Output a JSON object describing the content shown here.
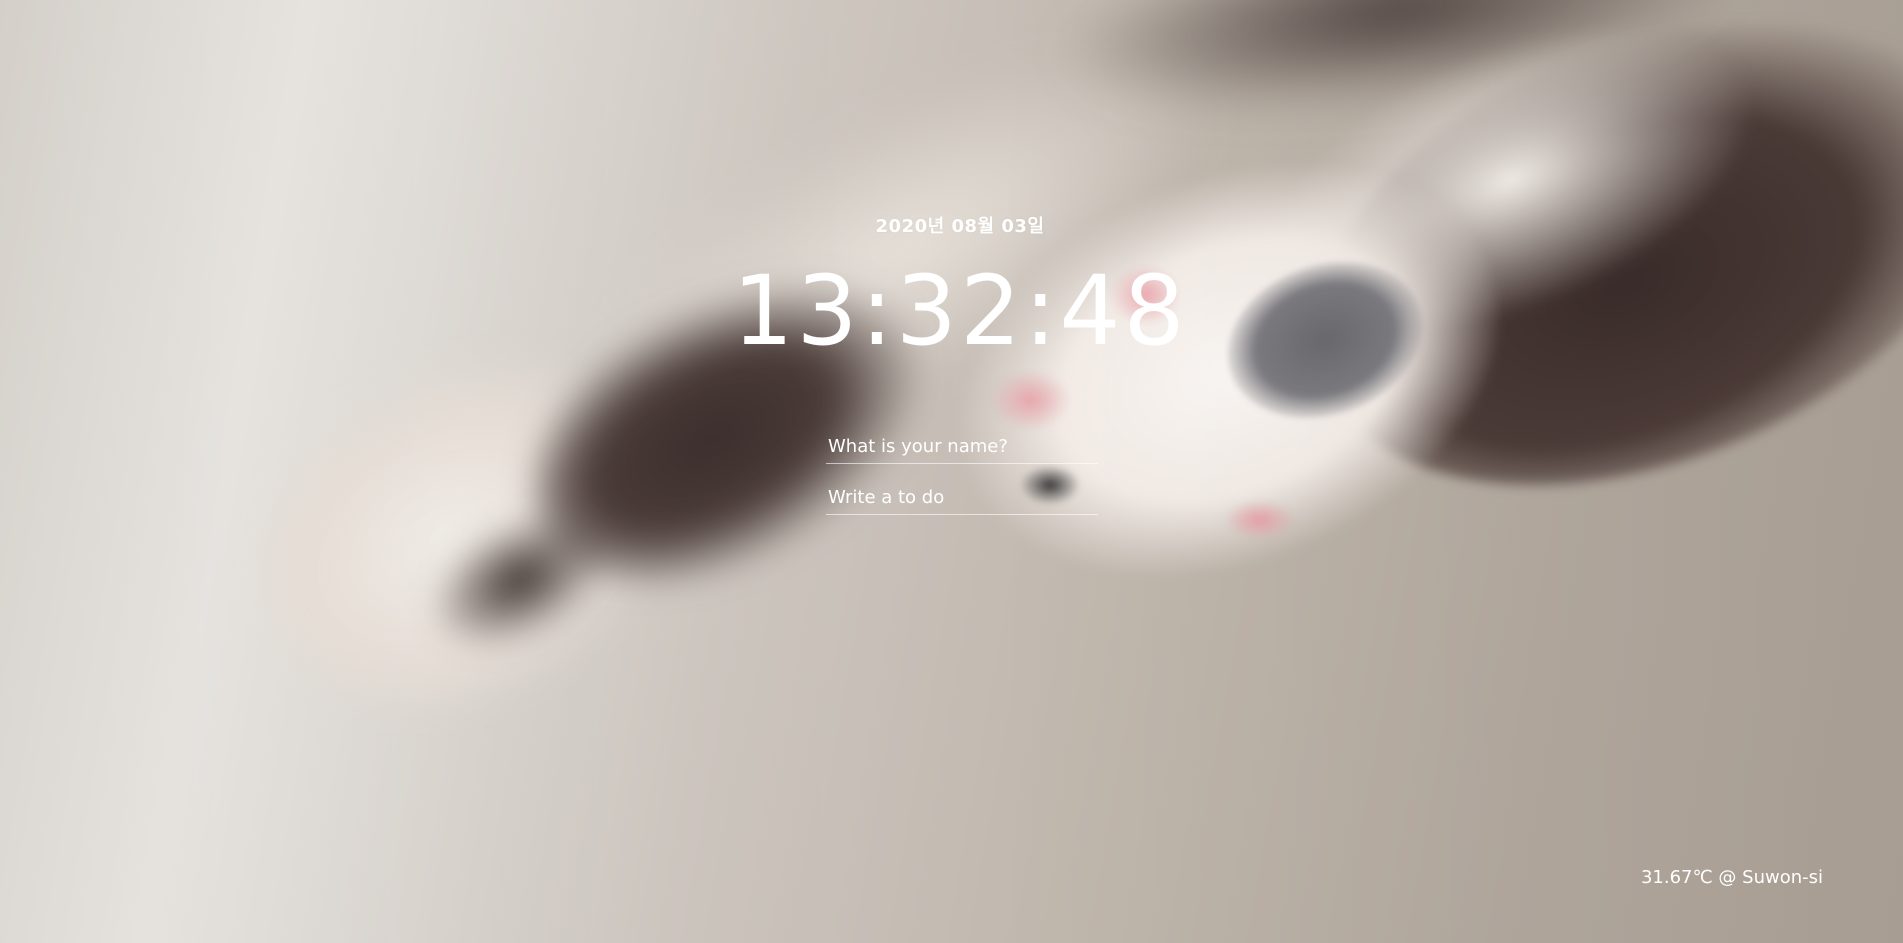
{
  "background": {
    "description_icon": "cat-paws-photo"
  },
  "date": "2020년 08월 03일",
  "clock": "13:32:48",
  "name_form": {
    "placeholder": "What is your name?",
    "value": ""
  },
  "todo_form": {
    "placeholder": "Write a to do",
    "value": ""
  },
  "weather": "31.67℃ @ Suwon-si",
  "colors": {
    "text": "#ffffff",
    "input_underline": "rgba(255,255,255,0.6)"
  }
}
